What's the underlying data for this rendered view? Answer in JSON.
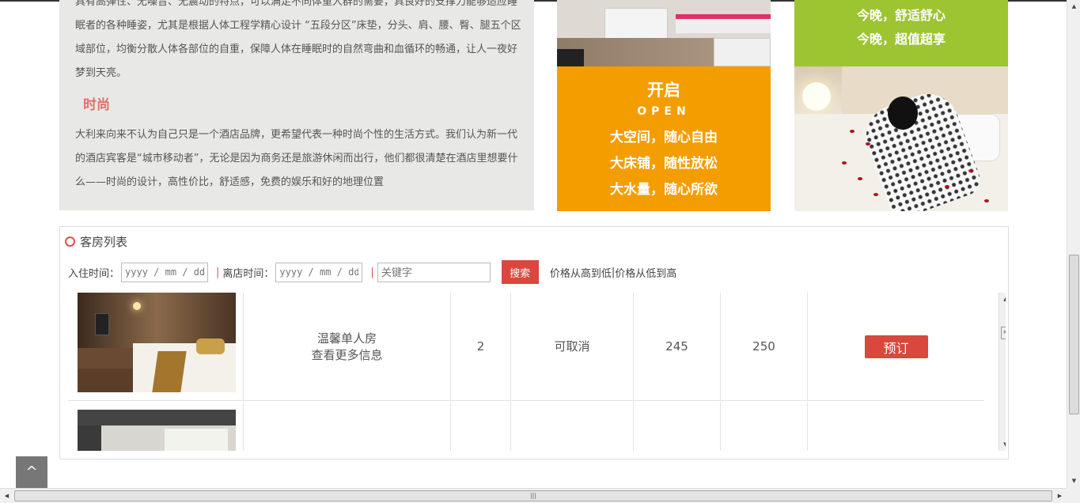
{
  "about": {
    "paragraph1": "具有高弹性、无噪音、无震动的特点，可以满足不同体重人群的需要，具良好的支撑力能够适应睡眠者的各种睡姿，尤其是根据人体工程学精心设计 “五段分区”床垫，分头、肩、腰、臀、腿五个区域部位，均衡分散人体各部位的自重，保障人体在睡眠时的自然弯曲和血循环的畅通，让人一夜好梦到天亮。",
    "heading": "时尚",
    "paragraph2": "大利来向来不认为自己只是一个酒店品牌，更希望代表一种时尚个性的生活方式。我们认为新一代的酒店宾客是“城市移动者”，无论是因为商务还是旅游休闲而出行，他们都很清楚在酒店里想要什么——时尚的设计，高性价比，舒适感，免费的娱乐和好的地理位置"
  },
  "promo_open": {
    "title": "开启",
    "subtitle": "OPEN",
    "lines": [
      "大空间，随心自由",
      "大床铺，随性放松",
      "大水量，随心所欲"
    ],
    "color": "#f49d00"
  },
  "promo_green": {
    "lines": [
      "今晚，舒适舒心",
      "今晚，超值超享"
    ],
    "color": "#9dc431"
  },
  "room_list": {
    "title": "客房列表",
    "checkin_label": "入住时间：",
    "checkout_label": "离店时间：",
    "date_placeholder": "yyyy / mm / dd",
    "separator": "|",
    "keyword_placeholder": "关键字",
    "search_label": "搜索",
    "sort_desc": "价格从高到低",
    "sort_asc": "价格从低到高",
    "accent_color": "#d9473d",
    "rows": [
      {
        "name": "温馨单人房",
        "more": "查看更多信息",
        "count": "2",
        "cancel": "可取消",
        "price": "245",
        "original_price": "250",
        "book_label": "预订"
      }
    ]
  },
  "back_to_top": "^",
  "icons": {
    "title_icon": "ring-icon",
    "scroll_up": "triangle-up-icon",
    "scroll_down": "triangle-down-icon"
  }
}
